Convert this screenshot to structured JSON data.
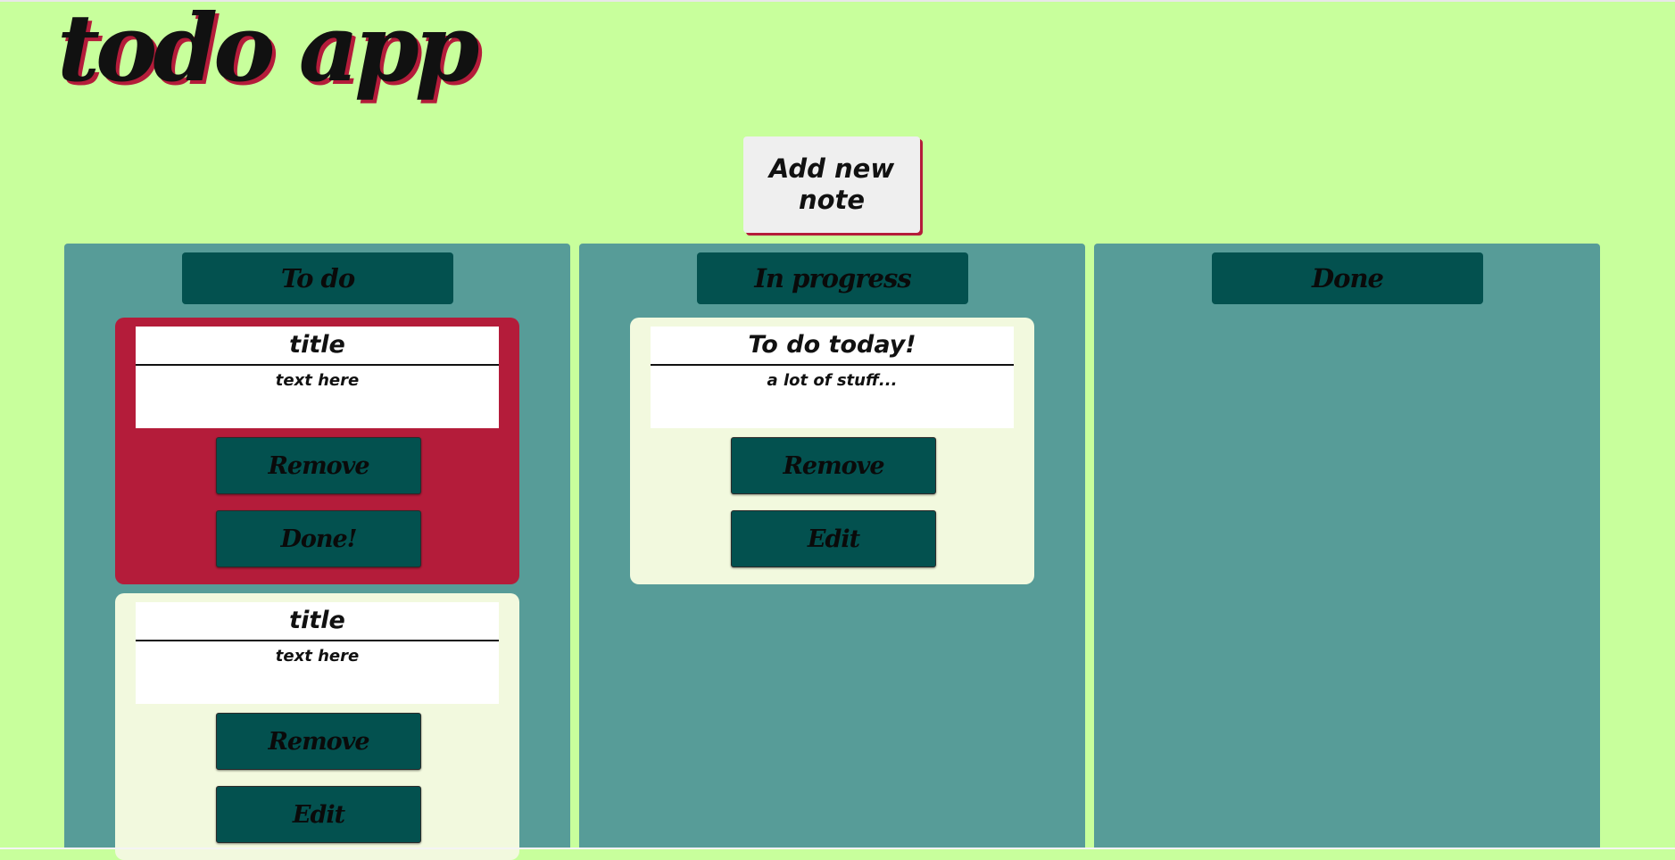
{
  "app": {
    "title": "todo app"
  },
  "add_button": {
    "label": "Add new note"
  },
  "columns": [
    {
      "title": "To do",
      "notes": [
        {
          "title": "title",
          "text": "text here",
          "highlighted": true,
          "buttons": [
            "Remove",
            "Done!"
          ]
        },
        {
          "title": "title",
          "text": "text here",
          "highlighted": false,
          "buttons": [
            "Remove",
            "Edit"
          ]
        }
      ]
    },
    {
      "title": "In progress",
      "notes": [
        {
          "title": "To do today!",
          "text": "a lot of stuff...",
          "highlighted": false,
          "buttons": [
            "Remove",
            "Edit"
          ]
        }
      ]
    },
    {
      "title": "Done",
      "notes": []
    }
  ],
  "colors": {
    "background": "#c8ff9c",
    "column": "#579c98",
    "header": "#03514f",
    "note_highlight": "#b41c3a",
    "note_default": "#f2f9de",
    "add_button_bg": "#efefef",
    "accent_shadow": "#b41c3a"
  }
}
